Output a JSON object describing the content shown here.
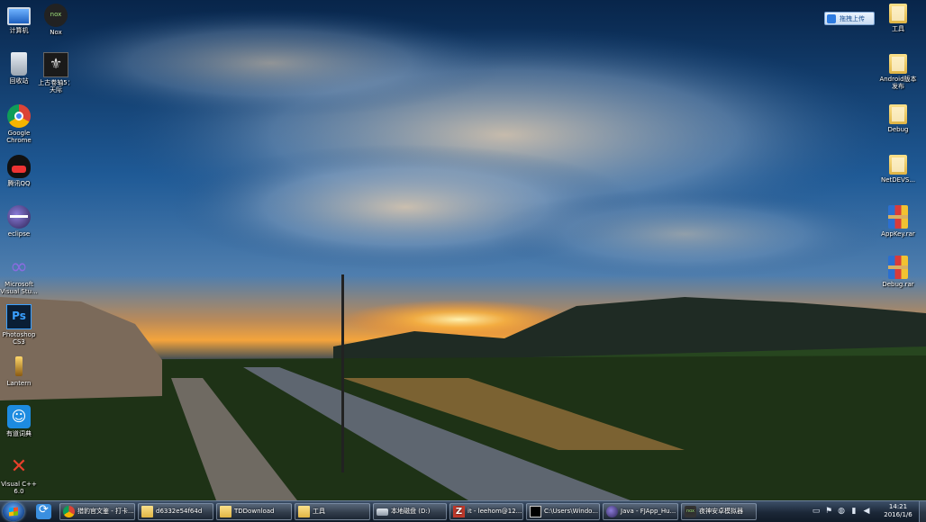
{
  "desktop_icons": {
    "computer": "计算机",
    "nox": "Nox",
    "recycle_bin": "回收站",
    "skyrim": "上古卷轴5：天际",
    "chrome": "Google Chrome",
    "qq": "腾讯QQ",
    "eclipse": "eclipse",
    "visual_studio": "Microsoft Visual Stu...",
    "photoshop": "Photoshop CS3",
    "lantern": "Lantern",
    "youdao": "有道词典",
    "visual_cpp": "Visual C++ 6.0",
    "tools": "工具",
    "android_publish": "Android版本发布",
    "debug_folder": "Debug",
    "netdevs": "NetDEVS...",
    "appkey_rar": "AppKey.rar",
    "debug_rar": "Debug.rar"
  },
  "upload_widget": {
    "label": "拖拽上传"
  },
  "taskbar": {
    "items": [
      {
        "label": "猎豹官文鉴 - 打卡..."
      },
      {
        "label": "d6332e54f64d"
      },
      {
        "label": "TDDownload"
      },
      {
        "label": "工具"
      },
      {
        "label": "本地磁盘 (D:)"
      },
      {
        "label": "it - leehom@12..."
      },
      {
        "label": "C:\\Users\\Windo..."
      },
      {
        "label": "Java - FJApp_Hu..."
      },
      {
        "label": "夜神安卓模拟器"
      }
    ],
    "clock": {
      "time": "14:21",
      "date": "2016/1/6"
    }
  },
  "colors": {
    "sky_top": "#0b2f5c",
    "sunset": "#f6a23a",
    "taskbar": "#1b2737"
  }
}
